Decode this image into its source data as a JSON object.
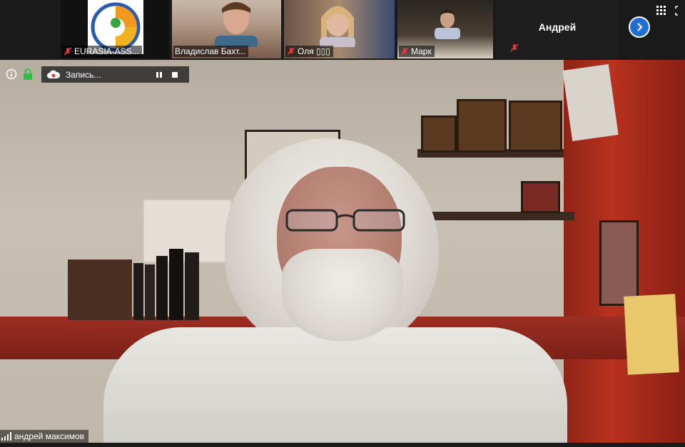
{
  "participants": [
    {
      "name": "EURASIA-ASS...",
      "muted": true
    },
    {
      "name": "Владислав Бахт...",
      "muted": false
    },
    {
      "name": "Оля ▯▯▯",
      "muted": true
    },
    {
      "name": "Марк",
      "muted": true
    },
    {
      "name": "Андрей",
      "muted": true
    }
  ],
  "icons": {
    "info": "info-icon",
    "security": "lock-icon",
    "recording": "cloud-record-icon",
    "pause": "pause-icon",
    "stop": "stop-icon",
    "next": "chevron-right-icon",
    "grid": "grid-view-icon",
    "expand": "expand-icon",
    "signal": "signal-icon",
    "muted": "mic-muted-icon"
  },
  "recording": {
    "label": "Запись..."
  },
  "speaker": {
    "name": "андрей максимов"
  },
  "colors": {
    "accent": "#1f6fd6",
    "muted_icon": "#e03a3a",
    "lock": "#2bbf4b"
  }
}
